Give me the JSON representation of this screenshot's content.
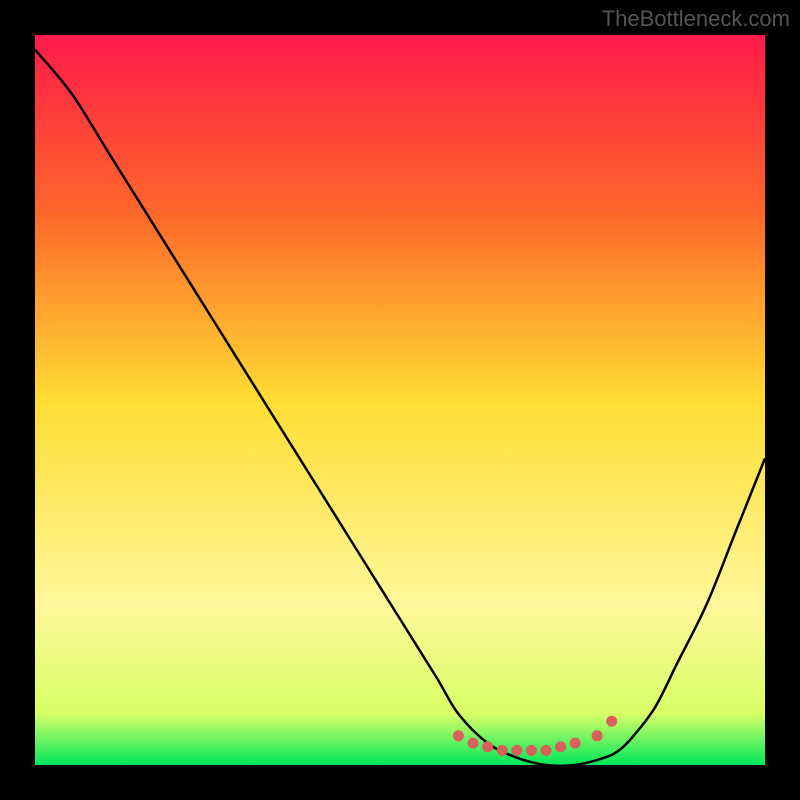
{
  "watermark": "TheBottleneck.com",
  "chart_data": {
    "type": "line",
    "title": "",
    "xlabel": "",
    "ylabel": "",
    "xlim": [
      0,
      100
    ],
    "ylim": [
      0,
      100
    ],
    "gradient_stops": [
      {
        "offset": 0.0,
        "color": "#ff1a4a"
      },
      {
        "offset": 0.25,
        "color": "#ff6a2a"
      },
      {
        "offset": 0.5,
        "color": "#ffdd33"
      },
      {
        "offset": 0.78,
        "color": "#fff79a"
      },
      {
        "offset": 0.93,
        "color": "#d8ff66"
      },
      {
        "offset": 1.0,
        "color": "#00e85c"
      }
    ],
    "series": [
      {
        "name": "bottleneck-curve",
        "x": [
          0,
          5,
          10,
          15,
          20,
          25,
          30,
          35,
          40,
          45,
          50,
          55,
          58,
          62,
          66,
          70,
          74,
          78,
          80,
          82,
          85,
          88,
          92,
          96,
          100
        ],
        "y": [
          98,
          92,
          84,
          76,
          68,
          60,
          52,
          44,
          36,
          28,
          20,
          12,
          7,
          3,
          1,
          0,
          0,
          1,
          2,
          4,
          8,
          14,
          22,
          32,
          42
        ]
      }
    ],
    "markers": {
      "name": "valley-markers",
      "color": "#d9605a",
      "points": [
        {
          "x": 58,
          "y": 4
        },
        {
          "x": 60,
          "y": 3
        },
        {
          "x": 62,
          "y": 2.5
        },
        {
          "x": 64,
          "y": 2
        },
        {
          "x": 66,
          "y": 2
        },
        {
          "x": 68,
          "y": 2
        },
        {
          "x": 70,
          "y": 2
        },
        {
          "x": 72,
          "y": 2.5
        },
        {
          "x": 74,
          "y": 3
        },
        {
          "x": 77,
          "y": 4
        },
        {
          "x": 79,
          "y": 6
        }
      ]
    }
  }
}
